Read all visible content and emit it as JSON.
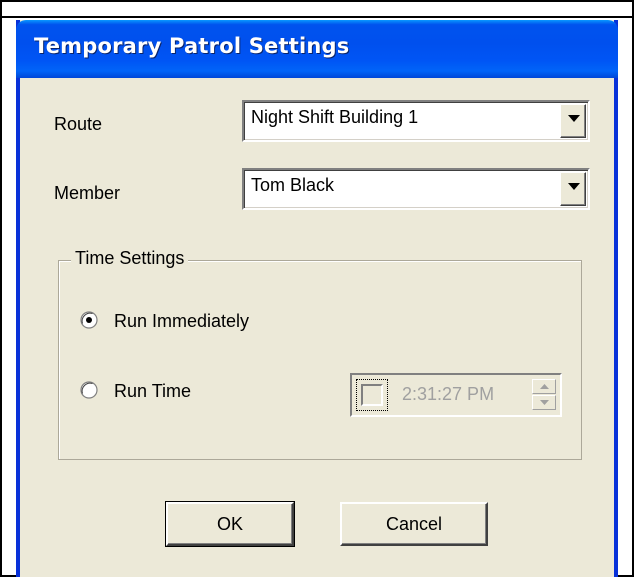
{
  "dialog": {
    "title": "Temporary Patrol Settings"
  },
  "route": {
    "label": "Route",
    "value": "Night Shift Building 1"
  },
  "member": {
    "label": "Member",
    "value": "Tom Black"
  },
  "time_settings": {
    "legend": "Time Settings",
    "options": [
      {
        "label": "Run Immediately",
        "selected": true
      },
      {
        "label": "Run Time",
        "selected": false
      }
    ],
    "time_value": "2:31:27 PM",
    "time_enabled": false
  },
  "buttons": {
    "ok_label": "OK",
    "cancel_label": "Cancel"
  },
  "colors": {
    "titlebar": "#0053ee",
    "dialog_bg": "#ece9d8",
    "disabled_text": "#a0a0a0"
  }
}
